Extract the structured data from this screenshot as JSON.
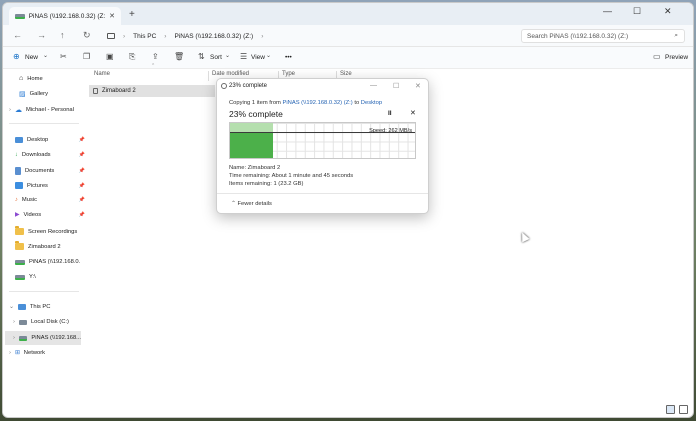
{
  "window": {
    "tab_title": "PiNAS (\\\\192.168.0.32) (Z:)",
    "new_tab": "+",
    "min": "—",
    "max": "☐",
    "close": "✕"
  },
  "address": {
    "crumbs": [
      "This PC",
      "PiNAS (\\\\192.168.0.32) (Z:)"
    ],
    "search_placeholder": "Search PiNAS (\\\\192.168.0.32) (Z:)"
  },
  "toolbar": {
    "new_label": "New",
    "sort_label": "Sort",
    "view_label": "View",
    "more_label": "•••",
    "preview_label": "Preview"
  },
  "sidebar": {
    "top": [
      {
        "label": "Home",
        "icon": "home-icon"
      },
      {
        "label": "Gallery",
        "icon": "gallery-icon"
      },
      {
        "label": "Michael - Personal",
        "icon": "cloud-icon"
      }
    ],
    "quick": [
      {
        "label": "Desktop",
        "pinned": true
      },
      {
        "label": "Downloads",
        "pinned": true
      },
      {
        "label": "Documents",
        "pinned": true
      },
      {
        "label": "Pictures",
        "pinned": true
      },
      {
        "label": "Music",
        "pinned": true
      },
      {
        "label": "Videos",
        "pinned": true
      },
      {
        "label": "Screen Recordings",
        "pinned": false
      },
      {
        "label": "Zimaboard 2",
        "pinned": false
      },
      {
        "label": "PiNAS (\\\\192.168.0.",
        "pinned": false
      },
      {
        "label": "Y:\\",
        "pinned": false
      }
    ],
    "tree": [
      {
        "label": "This PC"
      },
      {
        "label": "Local Disk (C:)"
      },
      {
        "label": "PiNAS (\\\\192.168..."
      },
      {
        "label": "Network"
      }
    ]
  },
  "columns": [
    "Name",
    "Date modified",
    "Type",
    "Size"
  ],
  "files": [
    {
      "name": "Zimaboard 2"
    }
  ],
  "dialog": {
    "title": "23% complete",
    "copying_prefix": "Copying 1 item from ",
    "source": "PiNAS (\\\\192.168.0.32) (Z:)",
    "to": " to ",
    "destination": "Desktop",
    "percent_text": "23% complete",
    "progress": 0.23,
    "speed": "Speed: 262 MB/s",
    "name_line": "Name:  Zimaboard 2",
    "time_line": "Time remaining:  About 1 minute and 45 seconds",
    "items_line": "Items remaining:  1 (23.2 GB)",
    "fewer_details": "Fewer details",
    "pause_glyph": "II",
    "stop_glyph": "✕"
  },
  "watermark": "K⊙ 大眼仔旭"
}
